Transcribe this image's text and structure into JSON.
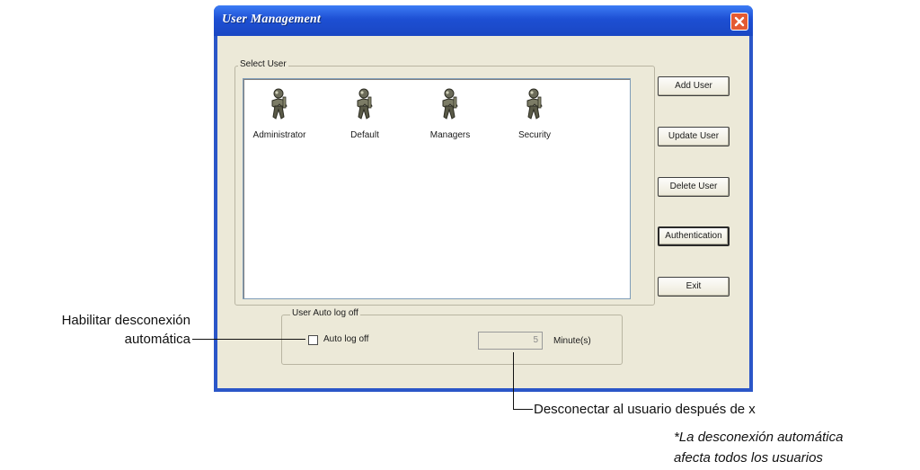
{
  "window": {
    "title": "User Management",
    "close_icon": "close-icon"
  },
  "select_user": {
    "group_label": "Select User",
    "users": [
      {
        "name": "Administrator",
        "icon": "user-key-icon"
      },
      {
        "name": "Default",
        "icon": "user-key-icon"
      },
      {
        "name": "Managers",
        "icon": "user-key-icon"
      },
      {
        "name": "Security",
        "icon": "user-key-icon"
      }
    ]
  },
  "buttons": {
    "add_user": "Add User",
    "update_user": "Update User",
    "delete_user": "Delete User",
    "authentication": "Authentication",
    "exit": "Exit"
  },
  "auto_logoff": {
    "group_label": "User Auto log off",
    "checkbox_label": "Auto log off",
    "checked": false,
    "minutes_value": "5",
    "minutes_label": "Minute(s)"
  },
  "annotations": {
    "enable_line1": "Habilitar desconexión",
    "enable_line2": "automática",
    "disconnect": "Desconectar al usuario después de x",
    "note_line1": "*La desconexión automática",
    "note_line2": "afecta todos los usuarios"
  },
  "colors": {
    "titlebar": "#1d4fd3",
    "client": "#ece9d8",
    "close": "#e45a32"
  }
}
